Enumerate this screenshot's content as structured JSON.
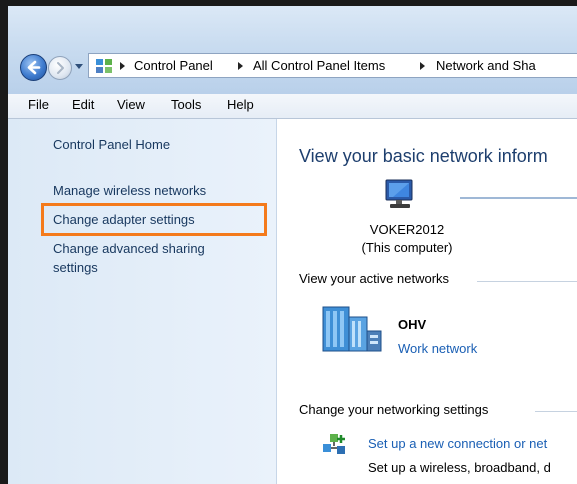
{
  "address_bar": {
    "breadcrumbs": [
      "Control Panel",
      "All Control Panel Items",
      "Network and Sha"
    ]
  },
  "menu": {
    "items": [
      "File",
      "Edit",
      "View",
      "Tools",
      "Help"
    ]
  },
  "sidebar": {
    "home": "Control Panel Home",
    "links": [
      "Manage wireless networks",
      "Change adapter settings",
      "Change advanced sharing",
      "settings"
    ],
    "highlight_color": "#f47a1b"
  },
  "main": {
    "title": "View your basic network inform",
    "computer": {
      "name": "VOKER2012",
      "subtitle": "(This computer)"
    },
    "active_networks_label": "View your active networks",
    "network": {
      "name": "OHV",
      "type": "Work network"
    },
    "change_settings_label": "Change your networking settings",
    "task": {
      "link": "Set up a new connection or net",
      "desc": "Set up a wireless, broadband, d"
    }
  },
  "icons": [
    "back-arrow-icon",
    "forward-arrow-icon",
    "control-panel-icon",
    "computer-icon",
    "network-building-icon",
    "new-connection-icon"
  ]
}
